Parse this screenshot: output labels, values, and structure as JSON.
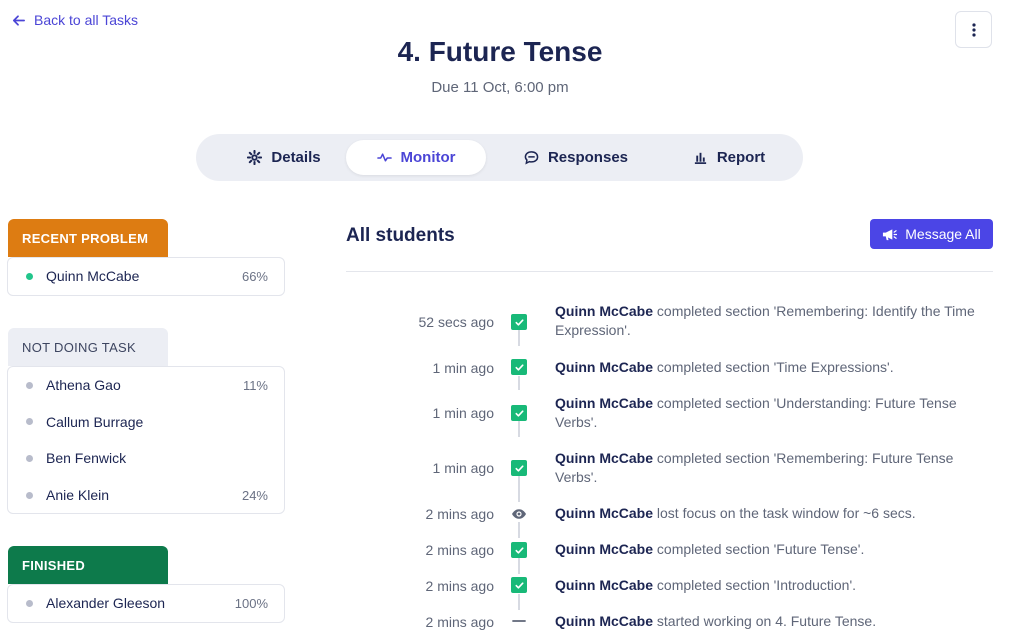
{
  "header": {
    "back_label": "Back to all Tasks",
    "title": "4. Future Tense",
    "due": "Due 11 Oct, 6:00 pm"
  },
  "tabs": [
    {
      "label": "Details",
      "icon": "gear-icon"
    },
    {
      "label": "Monitor",
      "icon": "activity-icon",
      "active": true
    },
    {
      "label": "Responses",
      "icon": "chat-icon"
    },
    {
      "label": "Report",
      "icon": "bar-chart-icon"
    }
  ],
  "groups": {
    "recent": {
      "title": "RECENT PROBLEM",
      "students": [
        {
          "name": "Quinn McCabe",
          "pct": "66%"
        }
      ]
    },
    "not_doing": {
      "title": "NOT DOING TASK",
      "students": [
        {
          "name": "Athena Gao",
          "pct": "11%"
        },
        {
          "name": "Callum Burrage",
          "pct": ""
        },
        {
          "name": "Ben Fenwick",
          "pct": ""
        },
        {
          "name": "Anie Klein",
          "pct": "24%"
        }
      ]
    },
    "finished": {
      "title": "FINISHED",
      "students": [
        {
          "name": "Alexander Gleeson",
          "pct": "100%"
        }
      ]
    }
  },
  "main": {
    "title": "All students",
    "message_all_label": "Message All"
  },
  "activity": [
    {
      "time": "52 secs ago",
      "icon": "check-icon",
      "student": "Quinn McCabe",
      "text": " completed section 'Remembering: Identify the Time Expression'."
    },
    {
      "time": "1 min ago",
      "icon": "check-icon",
      "student": "Quinn McCabe",
      "text": " completed section 'Time Expressions'."
    },
    {
      "time": "1 min ago",
      "icon": "check-icon",
      "student": "Quinn McCabe",
      "text": " completed section 'Understanding: Future Tense Verbs'."
    },
    {
      "time": "1 min ago",
      "icon": "check-icon",
      "student": "Quinn McCabe",
      "text": " completed section 'Remembering: Future Tense Verbs'."
    },
    {
      "time": "2 mins ago",
      "icon": "eye-icon",
      "student": "Quinn McCabe",
      "text": " lost focus on the task window for ~6 secs."
    },
    {
      "time": "2 mins ago",
      "icon": "check-icon",
      "student": "Quinn McCabe",
      "text": " completed section 'Future Tense'."
    },
    {
      "time": "2 mins ago",
      "icon": "check-icon",
      "student": "Quinn McCabe",
      "text": " completed section 'Introduction'."
    },
    {
      "time": "2 mins ago",
      "icon": "dash-icon",
      "student": "Quinn McCabe",
      "text": " started working on 4. Future Tense."
    }
  ],
  "colors": {
    "accent": "#4b45d6",
    "recent_problem": "#dd7c12",
    "finished": "#0d7a4b",
    "active_dot": "#22c58b",
    "inactive_dot": "#b8bccb",
    "check": "#18b978"
  }
}
